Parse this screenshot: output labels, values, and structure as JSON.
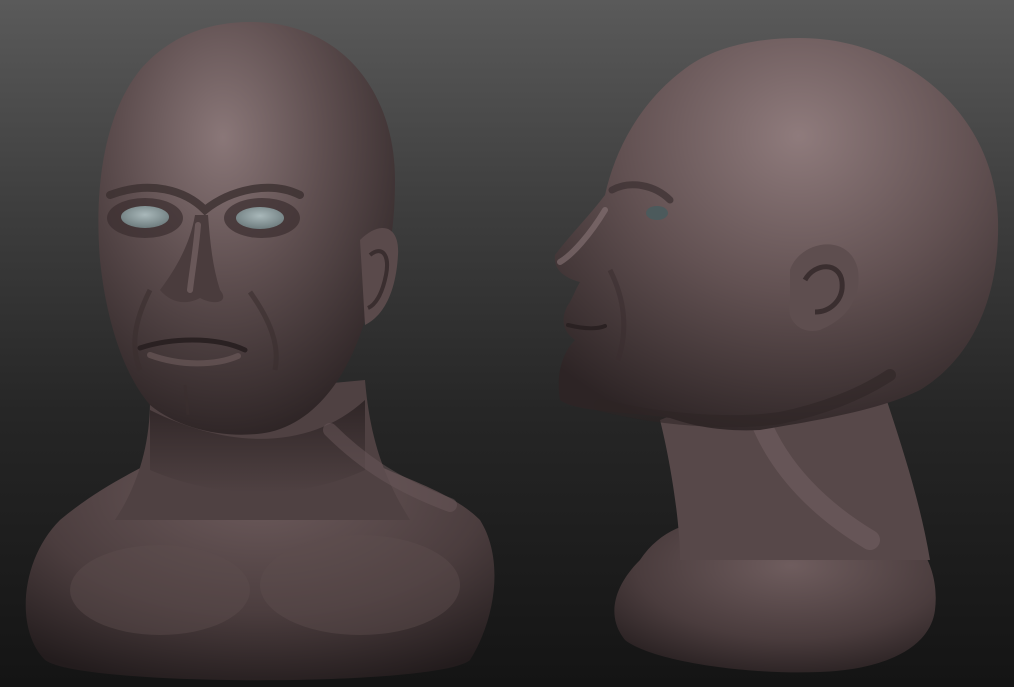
{
  "scene": {
    "background_gradient": [
      "#5a5a5a",
      "#3e3e3e",
      "#262626",
      "#141414"
    ],
    "material_colors": {
      "skin_base": "#5b4c4d",
      "skin_highlight": "#8a7778",
      "skin_shadow": "#2a2223",
      "eye": "#8fa0a3"
    },
    "objects": [
      {
        "name": "sculpted-head-front-view",
        "view": "front",
        "eyes_visible": true
      },
      {
        "name": "sculpted-head-side-view",
        "view": "profile-left",
        "eyes_visible": true
      }
    ]
  }
}
